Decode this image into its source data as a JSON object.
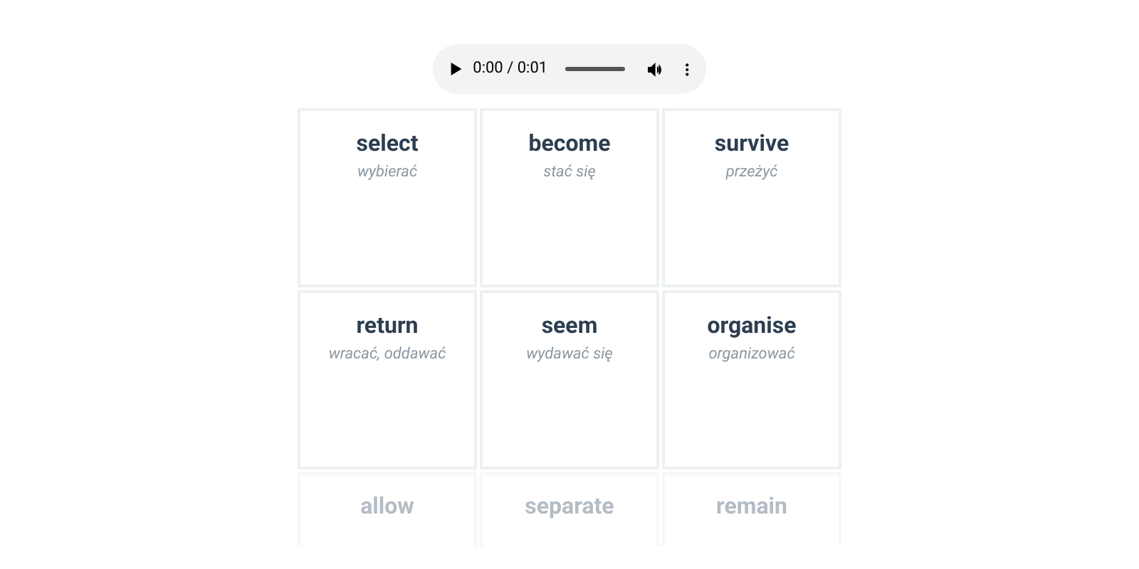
{
  "audio_player": {
    "time": "0:00 / 0:01"
  },
  "cards": [
    {
      "word": "select",
      "translation": "wybierać",
      "faded": false
    },
    {
      "word": "become",
      "translation": "stać się",
      "faded": false
    },
    {
      "word": "survive",
      "translation": "przeżyć",
      "faded": false
    },
    {
      "word": "return",
      "translation": "wracać, oddawać",
      "faded": false
    },
    {
      "word": "seem",
      "translation": "wydawać się",
      "faded": false
    },
    {
      "word": "organise",
      "translation": "organizować",
      "faded": false
    },
    {
      "word": "allow",
      "faded": true
    },
    {
      "word": "separate",
      "faded": true
    },
    {
      "word": "remain",
      "faded": true
    }
  ]
}
